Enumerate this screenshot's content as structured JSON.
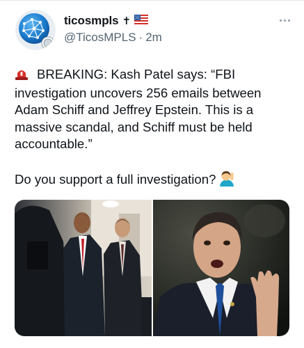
{
  "author": {
    "display_name": "ticosmpls",
    "name_suffix": "✝",
    "handle": "@TicosMPLS",
    "separator": "·",
    "time_ago": "2m"
  },
  "tweet": {
    "paragraph1": "BREAKING: Kash Patel says: “FBI investigation uncovers 256 emails between Adam Schiff and Jeffrey Epstein. This is a massive scandal, and Schiff must be held accountable.”",
    "paragraph2": "Do you support a full investigation?"
  },
  "icons": {
    "siren": "police-car-light-icon",
    "raise_hand": "person-raising-hand-icon",
    "flag": "us-flag-icon",
    "more": "more-options-icon"
  },
  "colors": {
    "text": "#0f1419",
    "muted": "#536471",
    "siren_red": "#d9302a",
    "avatar_blue": "#1e7fd0"
  }
}
